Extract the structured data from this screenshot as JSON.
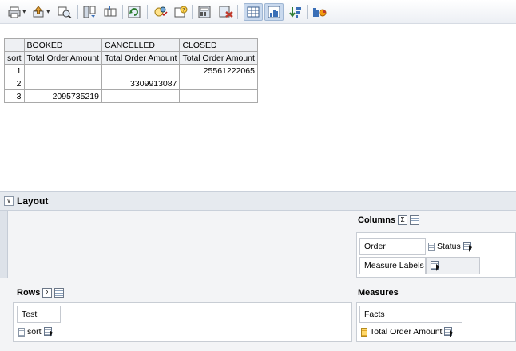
{
  "toolbar": {
    "buttons": [
      "print-icon",
      "export-icon",
      "view-options-icon",
      "pivot-icon",
      "insert-column-icon",
      "refresh-icon",
      "calculation-icon",
      "help-icon",
      "calculator-icon",
      "clear-icon",
      "table-view-icon",
      "chart-view-icon",
      "sort-icon",
      "format-icon"
    ]
  },
  "results": {
    "col_groups": [
      "BOOKED",
      "CANCELLED",
      "CLOSED"
    ],
    "row_header": "sort",
    "measure_label": "Total Order Amount",
    "rows": [
      {
        "sort": "1",
        "booked": "",
        "cancelled": "",
        "closed": "25561222065"
      },
      {
        "sort": "2",
        "booked": "",
        "cancelled": "3309913087",
        "closed": ""
      },
      {
        "sort": "3",
        "booked": "2095735219",
        "cancelled": "",
        "closed": ""
      }
    ]
  },
  "layout": {
    "title": "Layout",
    "columns_label": "Columns",
    "rows_label": "Rows",
    "measures_label": "Measures",
    "columns": {
      "order": "Order",
      "status": "Status",
      "measure_labels": "Measure Labels"
    },
    "rows": {
      "test": "Test",
      "sort": "sort"
    },
    "measures": {
      "facts": "Facts",
      "total": "Total Order Amount"
    }
  },
  "colors": {
    "toggle_bg": "#c9d9ee",
    "panel_bg": "#f3f4f6",
    "header_bg": "#e6eaef"
  }
}
